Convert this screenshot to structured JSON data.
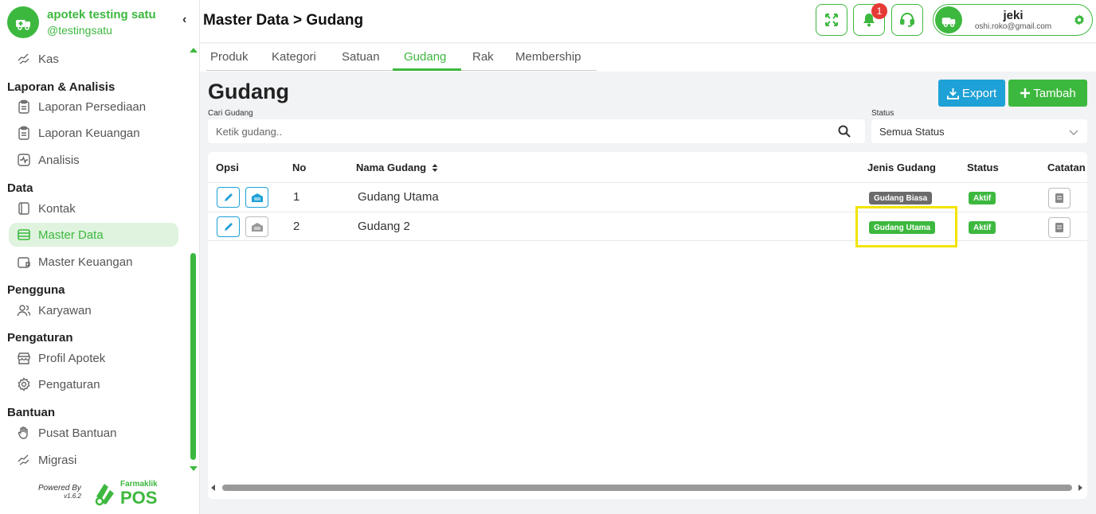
{
  "brand": {
    "name": "apotek testing satu",
    "handle": "@testingsatu"
  },
  "sidebar": {
    "collapse_glyph": "‹",
    "items": [
      {
        "type": "item",
        "label": "Kas",
        "icon": "coins-icon"
      },
      {
        "type": "section",
        "label": "Laporan & Analisis"
      },
      {
        "type": "item",
        "label": "Laporan Persediaan",
        "icon": "clipboard-icon"
      },
      {
        "type": "item",
        "label": "Laporan Keuangan",
        "icon": "clipboard-icon"
      },
      {
        "type": "item",
        "label": "Analisis",
        "icon": "activity-icon"
      },
      {
        "type": "section",
        "label": "Data"
      },
      {
        "type": "item",
        "label": "Kontak",
        "icon": "contact-book-icon"
      },
      {
        "type": "item",
        "label": "Master Data",
        "icon": "database-icon",
        "active": true
      },
      {
        "type": "item",
        "label": "Master Keuangan",
        "icon": "wallet-icon"
      },
      {
        "type": "section",
        "label": "Pengguna"
      },
      {
        "type": "item",
        "label": "Karyawan",
        "icon": "users-icon"
      },
      {
        "type": "section",
        "label": "Pengaturan"
      },
      {
        "type": "item",
        "label": "Profil Apotek",
        "icon": "store-icon"
      },
      {
        "type": "item",
        "label": "Pengaturan",
        "icon": "gear-icon"
      },
      {
        "type": "section",
        "label": "Bantuan"
      },
      {
        "type": "item",
        "label": "Pusat Bantuan",
        "icon": "hand-icon"
      },
      {
        "type": "item",
        "label": "Migrasi",
        "icon": "migrate-icon"
      }
    ],
    "powered_by": "Powered By",
    "version": "v1.6.2",
    "pos_brand_top": "Farmaklik",
    "pos_brand_bottom": "POS"
  },
  "header": {
    "title": "Master Data > Gudang",
    "notification_count": "1",
    "user": {
      "name": "jeki",
      "email": "oshi.roko@gmail.com"
    }
  },
  "tabs": [
    {
      "label": "Produk"
    },
    {
      "label": "Kategori"
    },
    {
      "label": "Satuan"
    },
    {
      "label": "Gudang",
      "active": true
    },
    {
      "label": "Rak"
    },
    {
      "label": "Membership"
    }
  ],
  "main": {
    "title": "Gudang",
    "export_label": "Export",
    "add_label": "Tambah",
    "search": {
      "label": "Cari Gudang",
      "placeholder": "Ketik gudang.."
    },
    "status_filter": {
      "label": "Status",
      "value": "Semua Status"
    }
  },
  "table": {
    "columns": [
      "Opsi",
      "No",
      "Nama Gudang",
      "Jenis Gudang",
      "Status",
      "Catatan"
    ],
    "rows": [
      {
        "no": "1",
        "name": "Gudang Utama",
        "type": "Gudang Biasa",
        "type_style": "dark",
        "status": "Aktif"
      },
      {
        "no": "2",
        "name": "Gudang 2",
        "type": "Gudang Utama",
        "type_style": "green",
        "status": "Aktif"
      }
    ]
  },
  "colors": {
    "brand_green": "#3db83f",
    "export_blue": "#1ea1d6",
    "highlight_yellow": "#f2e400",
    "badge_red": "#e53935"
  }
}
